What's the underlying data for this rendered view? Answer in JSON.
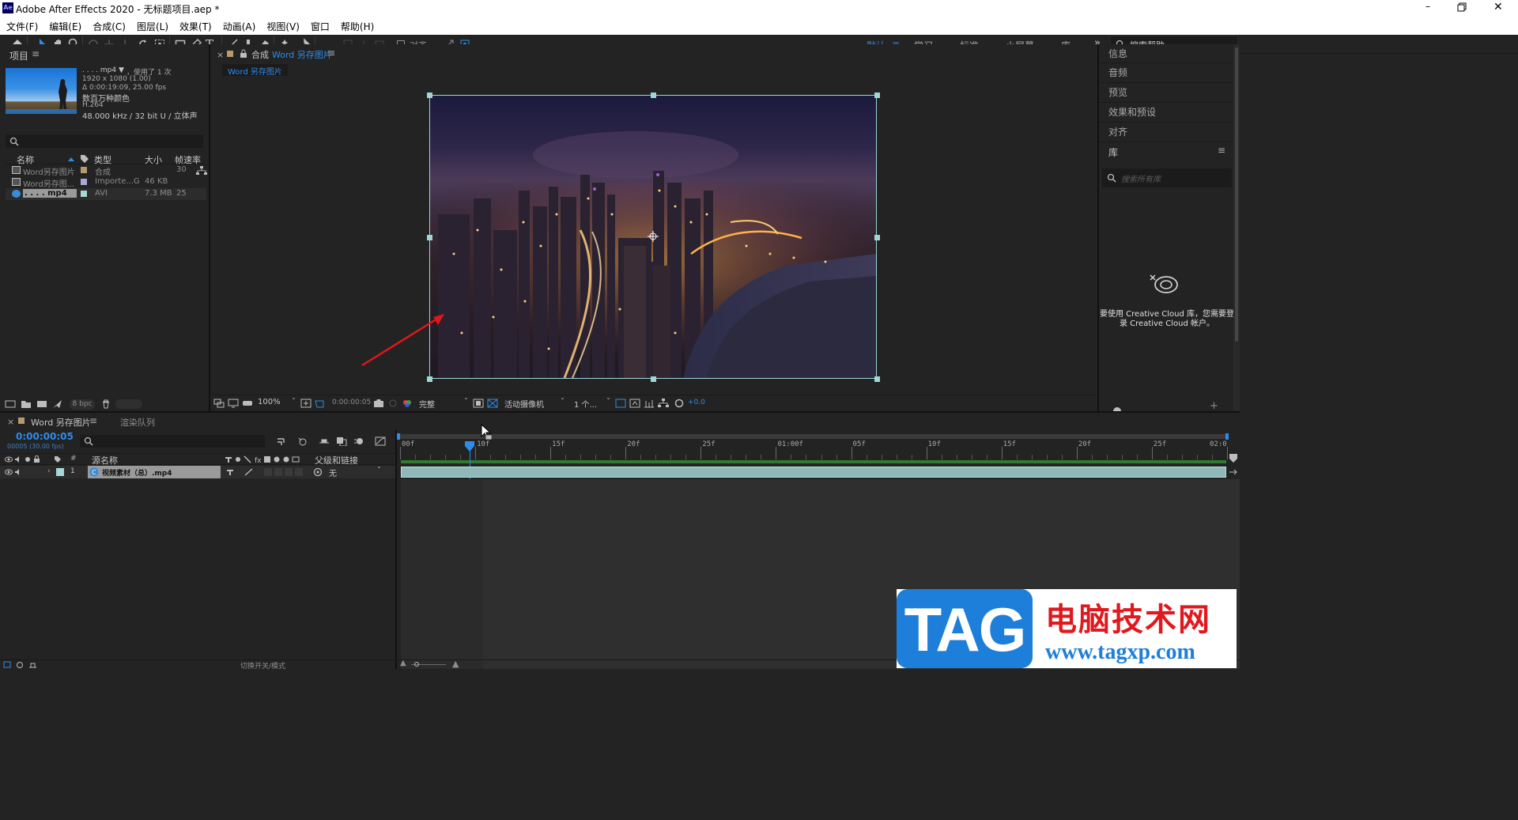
{
  "window": {
    "title": "Adobe After Effects 2020 - 无标题项目.aep *",
    "app_icon": "Ae"
  },
  "menu": [
    "文件(F)",
    "编辑(E)",
    "合成(C)",
    "图层(L)",
    "效果(T)",
    "动画(A)",
    "视图(V)",
    "窗口",
    "帮助(H)"
  ],
  "toolbar": {
    "snap_label": "对齐",
    "workspaces": [
      "默认",
      "学习",
      "标准",
      "小屏幕",
      "库"
    ],
    "active_workspace": "默认",
    "search_placeholder": "搜索帮助"
  },
  "project": {
    "title": "项目",
    "footage": {
      "name": ". . . . mp4 ▼",
      "used": "，使用了 1 次",
      "dims": "1920 x 1080 (1.00)",
      "duration": "Δ 0:00:19:09, 25.00 fps",
      "colors": "数百万种颜色",
      "codec": "H.264",
      "audio": "48.000 kHz / 32 bit U / 立体声"
    },
    "columns": [
      "名称",
      "类型",
      "大小",
      "帧速率"
    ],
    "items": [
      {
        "name": "Word另存图片",
        "type": "合成",
        "size": "",
        "fps": "30",
        "color": "#b59a6b"
      },
      {
        "name": "Word另存图...",
        "type": "Importe...G",
        "size": "46 KB",
        "fps": "",
        "color": "#a8a8d8"
      },
      {
        "name": ". . . . mp4",
        "type": "AVI",
        "size": "7.3 MB",
        "fps": "25",
        "color": "#a5d8d8"
      }
    ],
    "bpc": "8 bpc"
  },
  "composition": {
    "tab_prefix": "合成",
    "tab_name": "Word 另存图片",
    "breadcrumb": "Word 另存图片",
    "zoom": "100%",
    "timecode": "0:00:00:05",
    "resolution": "完整",
    "camera": "活动摄像机",
    "views": "1 个...",
    "exposure": "+0.0"
  },
  "right_panels": {
    "items": [
      "信息",
      "音频",
      "预览",
      "效果和预设",
      "对齐"
    ],
    "library_title": "库",
    "library_search_placeholder": "搜索所有库",
    "cc_message_line1": "要使用 Creative Cloud 库，您需要登",
    "cc_message_line2": "录 Creative Cloud 帐户。"
  },
  "timeline": {
    "tab_name": "Word 另存图片",
    "render_queue": "渲染队列",
    "timecode": "0:00:00:05",
    "frame_info": "00005 (30.00 fps)",
    "col_source": "源名称",
    "col_parent": "父级和链接",
    "layer": {
      "number": "1",
      "name": "视频素材（总）.mp4",
      "parent": "无"
    },
    "ruler": [
      "00f",
      "10f",
      "15f",
      "20f",
      "25f",
      "01:00f",
      "05f",
      "10f",
      "15f",
      "20f",
      "25f",
      "02:0"
    ],
    "footer": "切换开关/模式"
  },
  "watermark": {
    "logo": "TAG",
    "title": "电脑技术网",
    "url": "www.tagxp.com"
  },
  "colors": {
    "accent": "#2d8ceb",
    "panel": "#232323",
    "layer_bar": "#8fb8b8"
  }
}
